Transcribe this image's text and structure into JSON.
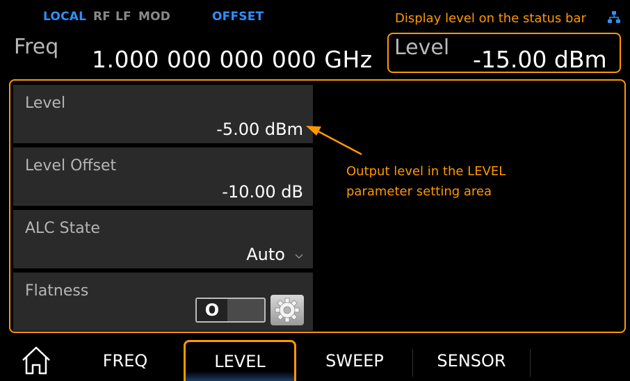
{
  "status": {
    "local": "LOCAL",
    "rf": "RF",
    "lf": "LF",
    "mod": "MOD",
    "offset": "OFFSET"
  },
  "annotations": {
    "status_bar_hint": "Display level on the status bar",
    "param_hint_line1": "Output level in the LEVEL",
    "param_hint_line2": "parameter setting area"
  },
  "header": {
    "freq_label": "Freq",
    "freq_value": "1.000 000 000 000  GHz",
    "level_label": "Level",
    "level_value": "-15.00  dBm"
  },
  "params": [
    {
      "label": "Level",
      "value": "-5.00 dBm"
    },
    {
      "label": "Level Offset",
      "value": "-10.00 dB"
    },
    {
      "label": "ALC State",
      "value": "Auto"
    },
    {
      "label": "Flatness",
      "toggle_text": "O"
    }
  ],
  "tabs": [
    {
      "label": "FREQ"
    },
    {
      "label": "LEVEL",
      "active": true
    },
    {
      "label": "SWEEP"
    },
    {
      "label": "SENSOR"
    }
  ],
  "colors": {
    "accent": "#ff9900",
    "status_active": "#2f8fff",
    "status_inactive": "#8a8a8a",
    "row_bg": "#2a2a2a"
  },
  "icons": [
    "network-icon",
    "chevron-down-icon",
    "gear-icon",
    "home-icon"
  ]
}
